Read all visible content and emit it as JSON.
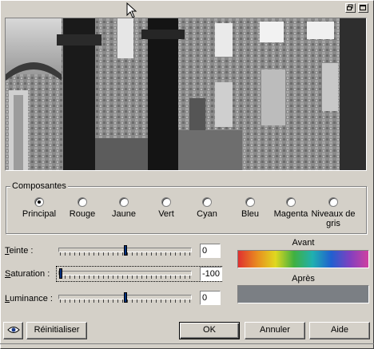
{
  "window": {
    "accent": "#d4d0c8"
  },
  "title_buttons": {
    "restore_icon": "restore-icon",
    "maximize_icon": "maximize-icon"
  },
  "preview": {
    "description_icon": "image-preview"
  },
  "composantes": {
    "label": "Composantes",
    "options": [
      {
        "label": "Principal",
        "selected": true
      },
      {
        "label": "Rouge",
        "selected": false
      },
      {
        "label": "Jaune",
        "selected": false
      },
      {
        "label": "Vert",
        "selected": false
      },
      {
        "label": "Cyan",
        "selected": false
      },
      {
        "label": "Bleu",
        "selected": false
      },
      {
        "label": "Magenta",
        "selected": false
      },
      {
        "label": "Niveaux de gris",
        "selected": false
      }
    ]
  },
  "sliders": [
    {
      "key": "teinte",
      "label_first": "T",
      "label_rest": "einte :",
      "value": "0",
      "range": [
        -100,
        100
      ]
    },
    {
      "key": "saturation",
      "label_first": "S",
      "label_rest": "aturation :",
      "value": "-100",
      "range": [
        -100,
        100
      ]
    },
    {
      "key": "luminance",
      "label_first": "L",
      "label_rest": "uminance :",
      "value": "0",
      "range": [
        -100,
        100
      ]
    }
  ],
  "colors": {
    "avant_label": "Avant",
    "apres_label": "Après",
    "apres_color": "#7b7f84"
  },
  "buttons": {
    "eye_icon": "eye-icon",
    "reset": "Réinitialiser",
    "ok": "OK",
    "cancel": "Annuler",
    "help": "Aide"
  }
}
